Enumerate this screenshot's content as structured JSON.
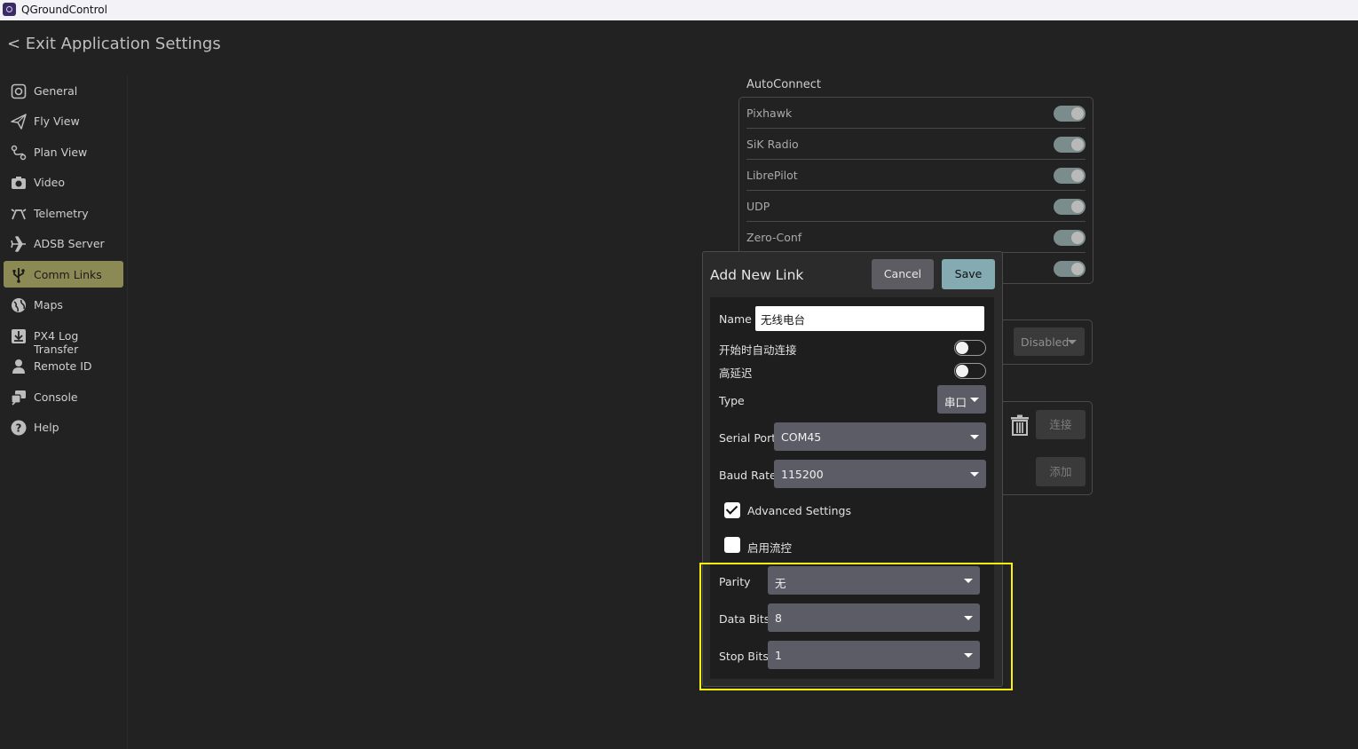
{
  "window": {
    "title": "QGroundControl"
  },
  "header": {
    "exit_label": "< Exit Application Settings"
  },
  "sidebar": {
    "items": [
      {
        "label": "General",
        "icon": "general-icon"
      },
      {
        "label": "Fly View",
        "icon": "paper-plane-icon"
      },
      {
        "label": "Plan View",
        "icon": "route-icon"
      },
      {
        "label": "Video",
        "icon": "camera-icon"
      },
      {
        "label": "Telemetry",
        "icon": "telemetry-icon"
      },
      {
        "label": "ADSB Server",
        "icon": "airplane-icon"
      },
      {
        "label": "Comm Links",
        "icon": "usb-icon",
        "selected": true
      },
      {
        "label": "Maps",
        "icon": "globe-icon"
      },
      {
        "label": "PX4 Log Transfer",
        "icon": "download-icon"
      },
      {
        "label": "Remote ID",
        "icon": "person-icon"
      },
      {
        "label": "Console",
        "icon": "console-icon"
      },
      {
        "label": "Help",
        "icon": "help-icon"
      }
    ]
  },
  "autoconnect": {
    "title": "AutoConnect",
    "items": [
      {
        "label": "Pixhawk",
        "on": true
      },
      {
        "label": "SiK Radio",
        "on": true
      },
      {
        "label": "LibrePilot",
        "on": true
      },
      {
        "label": "UDP",
        "on": true
      },
      {
        "label": "Zero-Conf",
        "on": true
      },
      {
        "label": "",
        "on": true
      }
    ]
  },
  "rtk": {
    "dropdown_value": "Disabled"
  },
  "links": {
    "connect_label": "连接",
    "add_label": "添加"
  },
  "dialog": {
    "title": "Add New Link",
    "cancel_label": "Cancel",
    "save_label": "Save",
    "name_label": "Name",
    "name_value": "无线电台",
    "autoconnect_label": "开始时自动连接",
    "autoconnect_on": false,
    "high_latency_label": "高延迟",
    "high_latency_on": false,
    "type_label": "Type",
    "type_value": "串口",
    "serial_port_label": "Serial Port",
    "serial_port_value": "COM45",
    "baud_rate_label": "Baud Rate",
    "baud_rate_value": "115200",
    "advanced_label": "Advanced Settings",
    "advanced_checked": true,
    "flow_control_label": "启用流控",
    "flow_control_checked": false,
    "parity_label": "Parity",
    "parity_value": "无",
    "data_bits_label": "Data Bits",
    "data_bits_value": "8",
    "stop_bits_label": "Stop Bits",
    "stop_bits_value": "1"
  },
  "colors": {
    "background": "#222222",
    "selected_nav": "#8c8a54",
    "save_button": "#84aab2",
    "highlight": "#ffee11"
  }
}
